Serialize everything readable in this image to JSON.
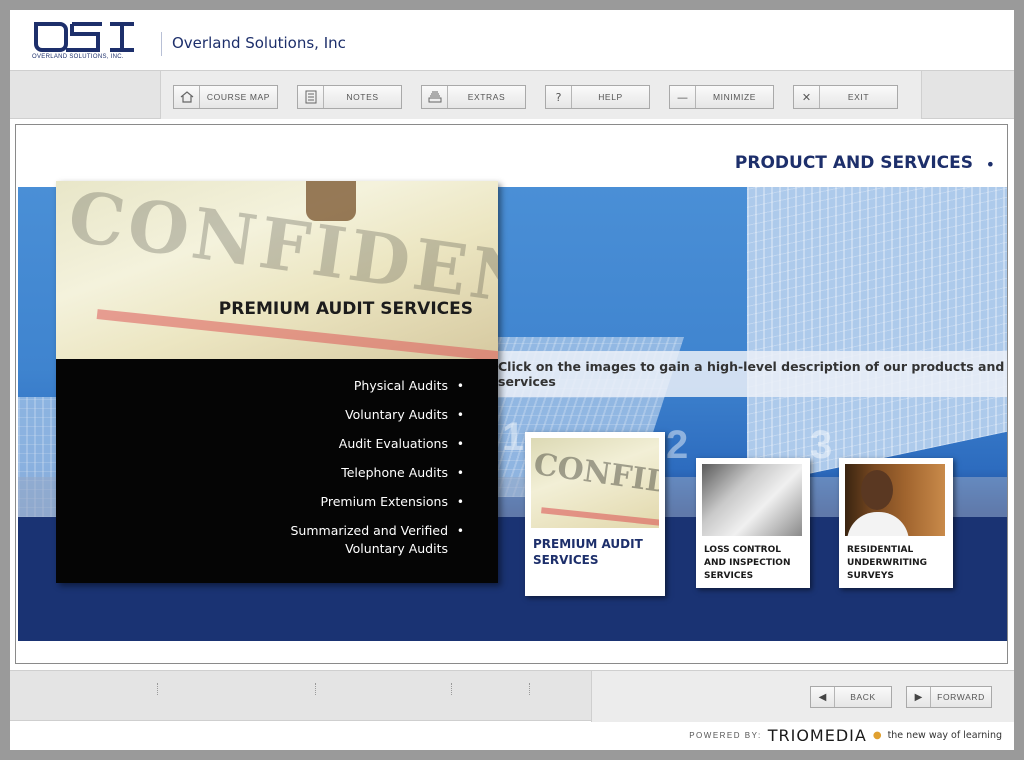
{
  "header": {
    "logo_text": "OSI",
    "logo_subtext": "OVERLAND SOLUTIONS, INC.",
    "company_name": "Overland Solutions, Inc"
  },
  "toolbar": {
    "buttons": [
      {
        "label": "COURSE MAP",
        "icon": "home-icon"
      },
      {
        "label": "NOTES",
        "icon": "document-icon"
      },
      {
        "label": "EXTRAS",
        "icon": "tray-icon"
      },
      {
        "label": "HELP",
        "icon": "question-icon"
      },
      {
        "label": "MINIMIZE",
        "icon": "minus-icon"
      },
      {
        "label": "EXIT",
        "icon": "close-icon"
      }
    ]
  },
  "main": {
    "section_title": "PRODUCT AND SERVICES",
    "instruction": "Click on the images to gain a high-level description of our products and services",
    "panel": {
      "title": "PREMIUM AUDIT SERVICES",
      "items": [
        "Physical Audits",
        "Voluntary Audits",
        "Audit Evaluations",
        "Telephone Audits",
        "Premium Extensions",
        "Summarized and Verified Voluntary Audits"
      ]
    },
    "cards": [
      {
        "number": "1",
        "title": "PREMIUM AUDIT SERVICES"
      },
      {
        "number": "2",
        "title": "LOSS CONTROL AND INSPECTION SERVICES"
      },
      {
        "number": "3",
        "title": "RESIDENTIAL UNDERWRITING SURVEYS"
      }
    ]
  },
  "footer": {
    "back_label": "BACK",
    "forward_label": "FORWARD",
    "powered_by": "POWERED BY:",
    "brand": "TRIOMEDIA",
    "tagline": "the new way of learning"
  },
  "colors": {
    "brand_navy": "#1d2f6b",
    "panel_black": "#050505",
    "hero_blue": "#3f84cf"
  }
}
